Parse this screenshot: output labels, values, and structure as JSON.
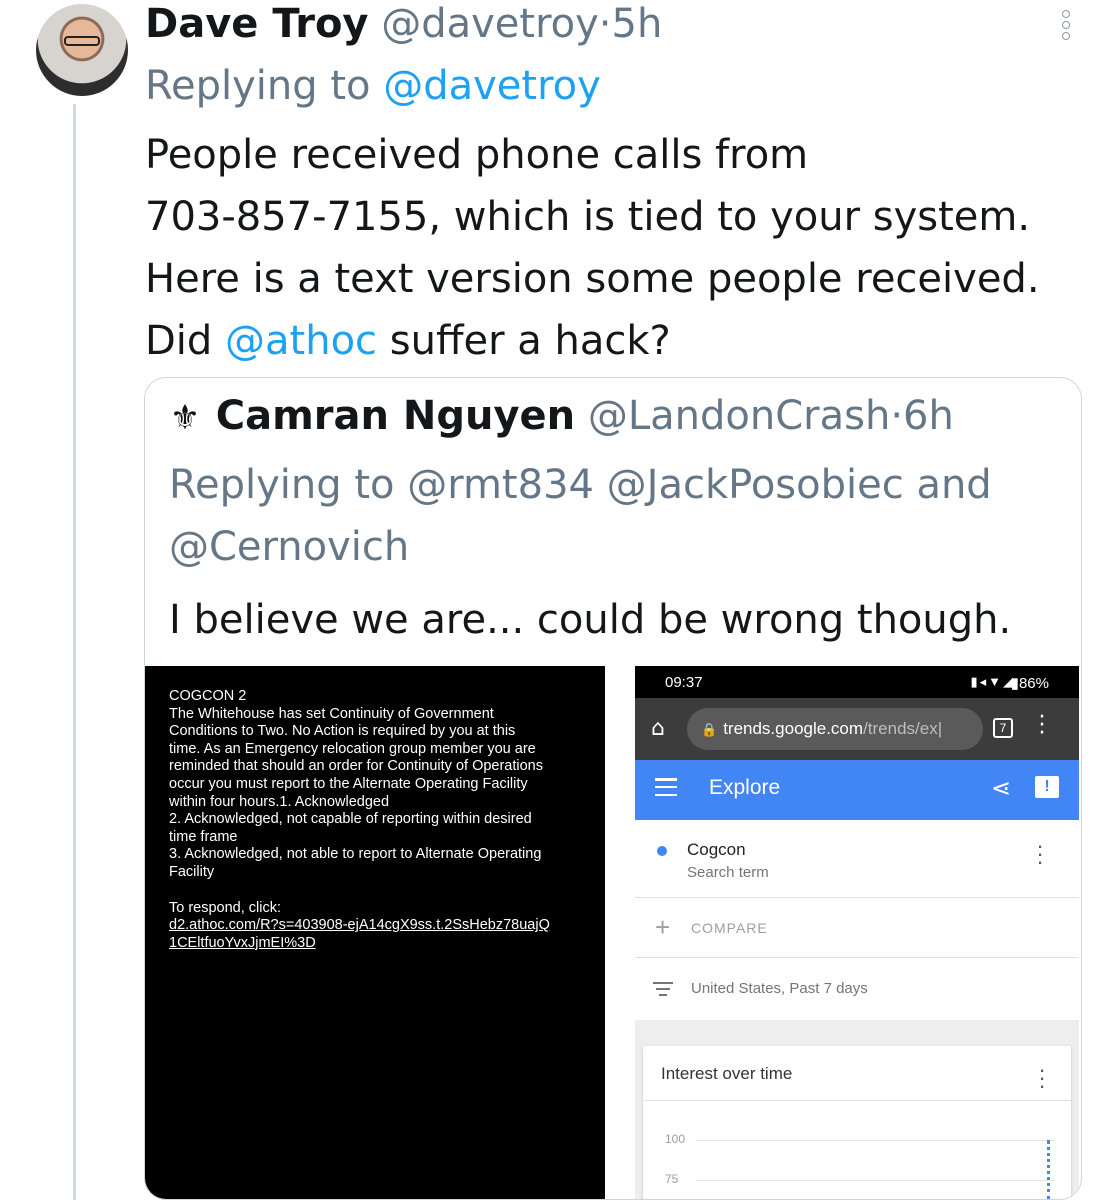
{
  "tweet": {
    "author_name": "Dave Troy",
    "author_handle": "@davetroy",
    "separator": "·",
    "time": "5h",
    "reply_prefix": "Replying to",
    "reply_to": "@davetroy",
    "text_line1": "People received phone calls from",
    "text_line2": "703-857-7155, which is tied to your system.",
    "text_line3": "Here is a text version some people received.",
    "text_line4_a": "Did",
    "text_line4_mention": "@athoc",
    "text_line4_b": "suffer a hack?"
  },
  "quoted": {
    "author_name": "Camran Nguyen",
    "author_handle": "@LandonCrash",
    "separator": "·",
    "time": "6h",
    "reply_line": "Replying to @rmt834 @JackPosobiec and @Cernovich",
    "text": "I believe we are... could be wrong though."
  },
  "sms_image": {
    "lines": [
      "COGCON 2",
      "The Whitehouse has set Continuity of Government",
      "Conditions to Two.  No Action is required by you at this",
      "time.  As an Emergency relocation group member you are",
      "reminded that should an order for Continuity of Operations",
      "occur you must report to the Alternate Operating Facility",
      "within four hours.1. Acknowledged",
      "2. Acknowledged, not capable of reporting within desired",
      "time frame",
      "3. Acknowledged, not able to report to Alternate Operating",
      "Facility"
    ],
    "respond_label": "To respond, click:",
    "link_line1": "d2.athoc.com/R?s=403908-ejA14cgX9ss.t.2SsHebz78uajQ",
    "link_line2": "1CEltfuoYvxJjmEI%3D"
  },
  "trends_image": {
    "status_time": "09:37",
    "status_battery": "86%",
    "url_main": "trends.google.com",
    "url_rest": "/trends/ex|",
    "tab_count": "7",
    "explore_title": "Explore",
    "term_name": "Cogcon",
    "term_type": "Search term",
    "compare_label": "COMPARE",
    "filter_label": "United States, Past 7 days",
    "card_title": "Interest over time",
    "tick_100": "100",
    "tick_75": "75"
  },
  "colors": {
    "link": "#1da1f2",
    "secondary_text": "#657786",
    "trends_blue": "#4285f4"
  },
  "icons": [
    "avatar",
    "more-icon",
    "saints-fleur-de-lis-icon",
    "home-icon",
    "lock-icon",
    "tabs-icon",
    "menu-icon",
    "share-icon",
    "feedback-icon",
    "plus-icon",
    "filter-icon",
    "kebab-icon"
  ]
}
